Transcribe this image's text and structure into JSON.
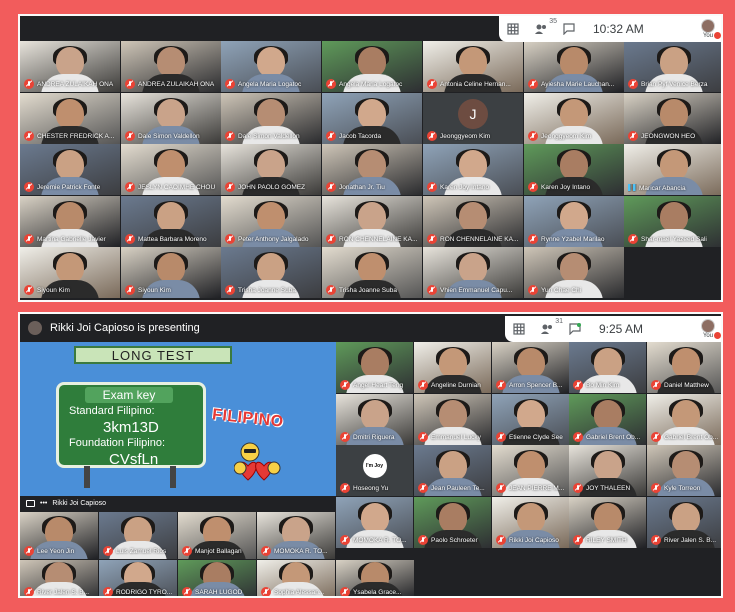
{
  "panel1": {
    "topbar": {
      "participants_count": "35",
      "time": "10:32 AM",
      "you_label": "You"
    },
    "tiles": [
      {
        "name": "ANDREA ZULAIKAH ONA",
        "muted": true
      },
      {
        "name": "ANDREA ZULAIKAH ONA",
        "muted": true
      },
      {
        "name": "Angela Maria Logatoc",
        "muted": true
      },
      {
        "name": "Angela Maria Logatoc",
        "muted": true
      },
      {
        "name": "Antonia Celine Hernan...",
        "muted": true
      },
      {
        "name": "Ayiesha Marie Lauchan...",
        "muted": true
      },
      {
        "name": "Brian Pyf Venice Berza",
        "muted": true
      },
      {
        "name": "CHESTER FREDRICK A...",
        "muted": true
      },
      {
        "name": "Dale Simon Valdellon",
        "muted": true
      },
      {
        "name": "Dale Simon Valdellon",
        "muted": true
      },
      {
        "name": "Jacob Tacorda",
        "muted": true
      },
      {
        "name": "Jeonggyeom Kim",
        "muted": true,
        "letter": "J"
      },
      {
        "name": "Jeonggyeom Kim",
        "muted": true
      },
      {
        "name": "JEONGWON HEO",
        "muted": true
      },
      {
        "name": "Jeremie Patrick Fonte",
        "muted": true
      },
      {
        "name": "JESLYN CAOIMHE CHOU",
        "muted": true
      },
      {
        "name": "JOHN PAOLO GOMEZ",
        "muted": true
      },
      {
        "name": "Jonathan Jr. Tiu",
        "muted": true
      },
      {
        "name": "Karen Joy Intano",
        "muted": true
      },
      {
        "name": "Karen Joy Intano",
        "muted": true
      },
      {
        "name": "Maricar Abancia",
        "muted": false
      },
      {
        "name": "Martina Gabrielle Javier",
        "muted": true
      },
      {
        "name": "Mattea Barbara Moreno",
        "muted": true
      },
      {
        "name": "Peter Anthony Jalgalado",
        "muted": true
      },
      {
        "name": "RON CHENNELAINE KA...",
        "muted": true
      },
      {
        "name": "RON CHENNELAINE KA...",
        "muted": true
      },
      {
        "name": "Rynne Yzabel Marilao",
        "muted": true
      },
      {
        "name": "Shar-mael Yazeed Sali",
        "muted": true
      },
      {
        "name": "Siyoun Kim",
        "muted": true
      },
      {
        "name": "Siyoun Kim",
        "muted": true
      },
      {
        "name": "Trisha Joanne Suba",
        "muted": true
      },
      {
        "name": "Trisha Joanne Suba",
        "muted": true
      },
      {
        "name": "Vhien Emmanuel Capu...",
        "muted": true
      },
      {
        "name": "Yun Chae Chi",
        "muted": true
      }
    ]
  },
  "panel2": {
    "presenting_text": "Rikki Joi Capioso is presenting",
    "topbar": {
      "participants_count": "31",
      "time": "9:25 AM",
      "you_label": "You"
    },
    "slide": {
      "title": "LONG TEST",
      "key_label": "Exam key",
      "line1": "Standard Filipino:",
      "code1": "3km13D",
      "line2": "Foundation Filipino:",
      "code2": "CVsfLn",
      "word": "FILIPINO"
    },
    "presenter_label": "Rikki Joi Capioso",
    "tiles": [
      {
        "name": "Angel Heart Teng"
      },
      {
        "name": "Angeline Durnian"
      },
      {
        "name": "Arron Spencer B..."
      },
      {
        "name": "Bo Min Kim"
      },
      {
        "name": "Daniel Matthew"
      },
      {
        "name": "Dmitri Riguera"
      },
      {
        "name": "Emmanuel Lucky"
      },
      {
        "name": "Etienne Clyde See"
      },
      {
        "name": "Gabriel Brent Ob..."
      },
      {
        "name": "Gabriel Brent Ob..."
      },
      {
        "name": "Hoseong Yu",
        "logo": "I'm Joy"
      },
      {
        "name": "Jean Pauleen Te..."
      },
      {
        "name": "JEAN PIERRE M..."
      },
      {
        "name": "JOY THALEEN"
      },
      {
        "name": "Kyle Torreon"
      },
      {
        "name": "MOMOKA R. TO..."
      },
      {
        "name": "Paolo Schroeter"
      },
      {
        "name": "Rikki Joi Capioso"
      },
      {
        "name": "RILEY SMITH"
      },
      {
        "name": "River Jalen S. B..."
      }
    ],
    "bottom_tiles": [
      {
        "name": "Lee Yeon Jin"
      },
      {
        "name": "Luis Zamuel Rios"
      },
      {
        "name": "Manjot Ballagan"
      },
      {
        "name": "MOMOKA R. TO..."
      },
      {
        "name": "River Jalen S. B..."
      },
      {
        "name": "RODRIGO TYRO..."
      },
      {
        "name": "SARAH LUGOD"
      },
      {
        "name": "Sophia Alessan..."
      },
      {
        "name": "Ysabela Grace..."
      }
    ]
  }
}
